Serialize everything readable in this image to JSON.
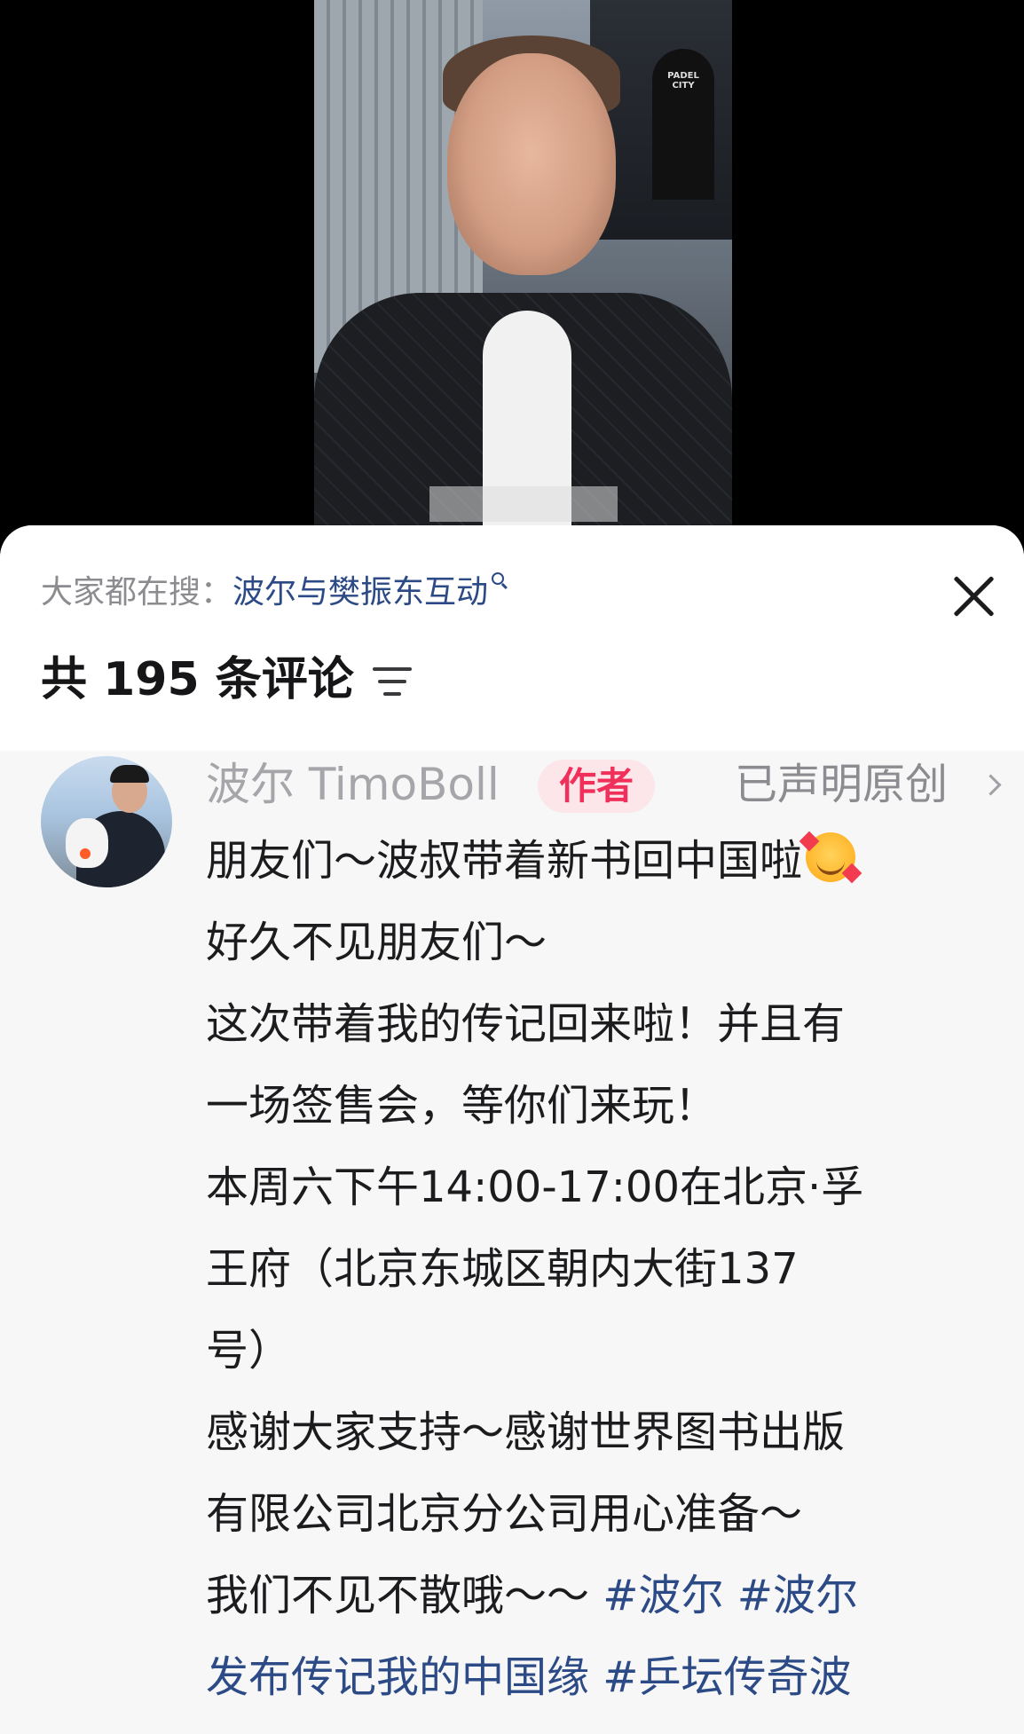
{
  "search": {
    "prefix": "大家都在搜：",
    "query": "波尔与樊振东互动"
  },
  "comments_header": {
    "count_text": "共 195 条评论"
  },
  "video": {
    "banner_text": "PADEL CITY"
  },
  "comment": {
    "username": "波尔 TimoBoll",
    "author_badge": "作者",
    "original_tag": "已声明原创",
    "lines": [
      "朋友们～波叔带着新书回中国啦",
      "好久不见朋友们～",
      "这次带着我的传记回来啦！并且有",
      "一场签售会，等你们来玩！",
      "本周六下午14:00-17:00在北京·孚",
      "王府（北京东城区朝内大街137",
      "号）",
      "感谢大家支持～感谢世界图书出版",
      "有限公司北京分公司用心准备～"
    ],
    "last_line_text": "我们不见不散哦～～ ",
    "hashtags": [
      "#波尔",
      "#波尔",
      "发布传记我的中国缘",
      "#乒坛传奇波"
    ]
  }
}
